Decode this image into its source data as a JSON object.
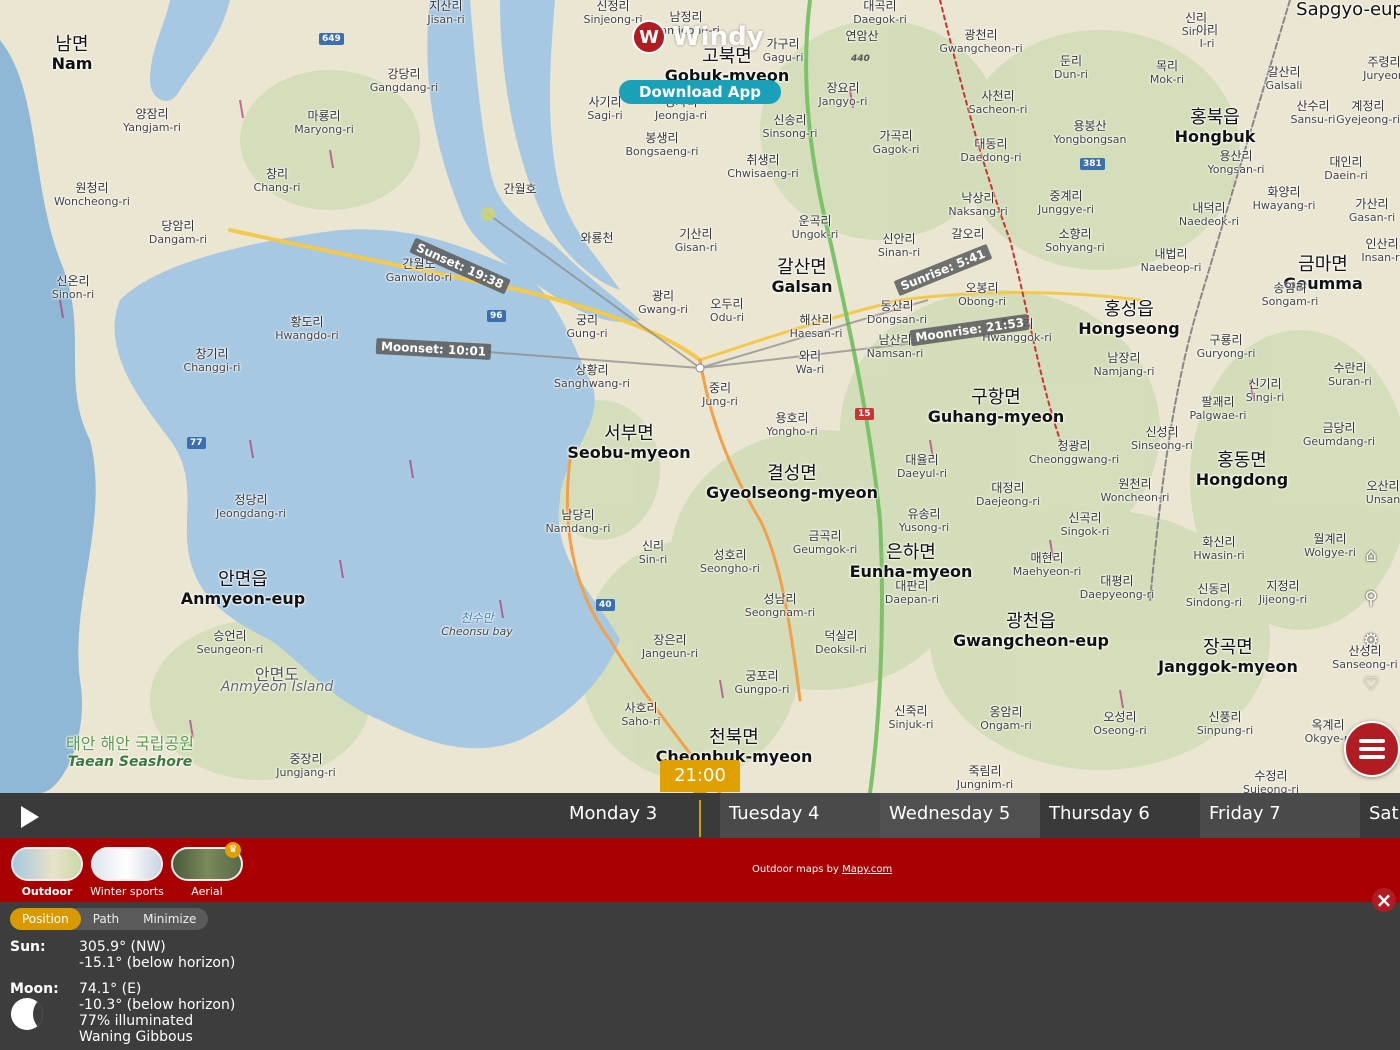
{
  "app": {
    "brand_name": "Windy",
    "download_label": "Download App",
    "brand_color": "#b01c22",
    "accent_color": "#d99a00"
  },
  "map": {
    "overlays": {
      "sunset": "Sunset: 19:38",
      "sunrise": "Sunrise: 5:41",
      "moonset": "Moonset: 10:01",
      "moonrise": "Moonrise: 21:53"
    },
    "road_shields": [
      "649",
      "440",
      "381",
      "96",
      "15",
      "77",
      "40"
    ],
    "places": [
      {
        "ko": "남면",
        "ro": "Nam",
        "big": true
      },
      {
        "ko": "지산리",
        "ro": "Jisan-ri"
      },
      {
        "ko": "신정리",
        "ro": "Sinjeong-ri"
      },
      {
        "ko": "남정리",
        "ro": "Namjeong-ri"
      },
      {
        "ko": "고북면",
        "ro": "Gobuk-myeon",
        "big": true
      },
      {
        "ko": "가구리",
        "ro": "Gagu-ri"
      },
      {
        "ko": "대곡리",
        "ro": "Daegok-ri"
      },
      {
        "ko": "연암산",
        "ro": ""
      },
      {
        "ko": "광천리",
        "ro": "Gwangcheon-ri"
      },
      {
        "ko": "신리",
        "ro": "Sin-ri"
      },
      {
        "ko": "이리",
        "ro": "I-ri"
      },
      {
        "ko": "둔리",
        "ro": "Dun-ri"
      },
      {
        "ko": "목리",
        "ro": "Mok-ri"
      },
      {
        "ko": "갈산리",
        "ro": "Galsali"
      },
      {
        "ko": "주령리",
        "ro": "Juryeon"
      },
      {
        "ko": "강당리",
        "ro": "Gangdang-ri"
      },
      {
        "ko": "사기리",
        "ro": "Sagi-ri"
      },
      {
        "ko": "정자리",
        "ro": "Jeongja-ri"
      },
      {
        "ko": "장요리",
        "ro": "Jangyo-ri"
      },
      {
        "ko": "양잠리",
        "ro": "Yangjam-ri"
      },
      {
        "ko": "마룡리",
        "ro": "Maryong-ri"
      },
      {
        "ko": "봉생리",
        "ro": "Bongsaeng-ri"
      },
      {
        "ko": "신송리",
        "ro": "Sinsong-ri"
      },
      {
        "ko": "가곡리",
        "ro": "Gagok-ri"
      },
      {
        "ko": "사천리",
        "ro": "Sacheon-ri"
      },
      {
        "ko": "대동리",
        "ro": "Daedong-ri"
      },
      {
        "ko": "용봉산",
        "ro": "Yongbongsan"
      },
      {
        "ko": "홍북읍",
        "ro": "Hongbuk",
        "big": true
      },
      {
        "ko": "산수리",
        "ro": "Sansu-ri"
      },
      {
        "ko": "계정리",
        "ro": "Gyejeong-ri"
      },
      {
        "ko": "창리",
        "ro": "Chang-ri"
      },
      {
        "ko": "간월호",
        "ro": ""
      },
      {
        "ko": "취생리",
        "ro": "Chwisaeng-ri"
      },
      {
        "ko": "용산리",
        "ro": "Yongsan-ri"
      },
      {
        "ko": "대인리",
        "ro": "Daein-ri"
      },
      {
        "ko": "원청리",
        "ro": "Woncheong-ri"
      },
      {
        "ko": "당암리",
        "ro": "Dangam-ri"
      },
      {
        "ko": "운곡리",
        "ro": "Ungok-ri"
      },
      {
        "ko": "낙상리",
        "ro": "Naksang-ri"
      },
      {
        "ko": "중계리",
        "ro": "Junggye-ri"
      },
      {
        "ko": "화양리",
        "ro": "Hwayang-ri"
      },
      {
        "ko": "가산리",
        "ro": "Gasan-ri"
      },
      {
        "ko": "와룡천",
        "ro": ""
      },
      {
        "ko": "기산리",
        "ro": "Gisan-ri"
      },
      {
        "ko": "내덕리",
        "ro": "Naedeok-ri"
      },
      {
        "ko": "인산리",
        "ro": "Insan-ri"
      },
      {
        "ko": "간월도",
        "ro": "Ganwoldo-ri"
      },
      {
        "ko": "갈산면",
        "ro": "Galsan",
        "big": true
      },
      {
        "ko": "신안리",
        "ro": "Sinan-ri"
      },
      {
        "ko": "갈오리",
        "ro": ""
      },
      {
        "ko": "소향리",
        "ro": "Sohyang-ri"
      },
      {
        "ko": "내법리",
        "ro": "Naebeop-ri"
      },
      {
        "ko": "금마면",
        "ro": "Geumma",
        "big": true
      },
      {
        "ko": "신온리",
        "ro": "Sinon-ri"
      },
      {
        "ko": "광리",
        "ro": "Gwang-ri"
      },
      {
        "ko": "오두리",
        "ro": "Odu-ri"
      },
      {
        "ko": "오봉리",
        "ro": "Obong-ri"
      },
      {
        "ko": "홍성읍",
        "ro": "Hongseong",
        "big": true
      },
      {
        "ko": "송암리",
        "ro": "Songam-ri"
      },
      {
        "ko": "황도리",
        "ro": "Hwangdo-ri"
      },
      {
        "ko": "궁리",
        "ro": "Gung-ri"
      },
      {
        "ko": "해산리",
        "ro": "Haesan-ri"
      },
      {
        "ko": "동산리",
        "ro": "Dongsan-ri"
      },
      {
        "ko": "황곡리",
        "ro": "Hwanggok-ri"
      },
      {
        "ko": "구룡리",
        "ro": "Guryong-ri"
      },
      {
        "ko": "창기리",
        "ro": "Changgi-ri"
      },
      {
        "ko": "상황리",
        "ro": "Sanghwang-ri"
      },
      {
        "ko": "와리",
        "ro": "Wa-ri"
      },
      {
        "ko": "남산리",
        "ro": "Namsan-ri"
      },
      {
        "ko": "남장리",
        "ro": "Namjang-ri"
      },
      {
        "ko": "수란리",
        "ro": "Suran-ri"
      },
      {
        "ko": "중리",
        "ro": "Jung-ri"
      },
      {
        "ko": "구항면",
        "ro": "Guhang-myeon",
        "big": true
      },
      {
        "ko": "신기리",
        "ro": "Singi-ri"
      },
      {
        "ko": "팔괘리",
        "ro": "Palgwae-ri"
      },
      {
        "ko": "용호리",
        "ro": "Yongho-ri"
      },
      {
        "ko": "서부면",
        "ro": "Seobu-myeon",
        "big": true
      },
      {
        "ko": "청광리",
        "ro": "Cheonggwang-ri"
      },
      {
        "ko": "신성리",
        "ro": "Sinseong-ri"
      },
      {
        "ko": "금당리",
        "ro": "Geumdang-ri"
      },
      {
        "ko": "대율리",
        "ro": "Daeyul-ri"
      },
      {
        "ko": "결성면",
        "ro": "Gyeolseong-myeon",
        "big": true
      },
      {
        "ko": "홍동면",
        "ro": "Hongdong",
        "big": true
      },
      {
        "ko": "원천리",
        "ro": "Woncheon-ri"
      },
      {
        "ko": "오산리",
        "ro": "Unsan"
      },
      {
        "ko": "대정리",
        "ro": "Daejeong-ri"
      },
      {
        "ko": "신곡리",
        "ro": "Singok-ri"
      },
      {
        "ko": "정당리",
        "ro": "Jeongdang-ri"
      },
      {
        "ko": "남당리",
        "ro": "Namdang-ri"
      },
      {
        "ko": "유송리",
        "ro": "Yusong-ri"
      },
      {
        "ko": "금곡리",
        "ro": "Geumgok-ri"
      },
      {
        "ko": "신리",
        "ro": "Sin-ri"
      },
      {
        "ko": "화신리",
        "ro": "Hwasin-ri"
      },
      {
        "ko": "월계리",
        "ro": "Wolgye-ri"
      },
      {
        "ko": "은하면",
        "ro": "Eunha-myeon",
        "big": true
      },
      {
        "ko": "성호리",
        "ro": "Seongho-ri"
      },
      {
        "ko": "매현리",
        "ro": "Maehyeon-ri"
      },
      {
        "ko": "대평리",
        "ro": "Daepyeong-ri"
      },
      {
        "ko": "안면읍",
        "ro": "Anmyeon-eup",
        "big": true
      },
      {
        "ko": "신동리",
        "ro": "Sindong-ri"
      },
      {
        "ko": "지정리",
        "ro": "Jijeong-ri"
      },
      {
        "ko": "대판리",
        "ro": "Daepan-ri"
      },
      {
        "ko": "성남리",
        "ro": "Seongnam-ri"
      },
      {
        "ko": "천수만",
        "ro": "Cheonsu bay",
        "water": true
      },
      {
        "ko": "광천읍",
        "ro": "Gwangcheon-eup",
        "big": true
      },
      {
        "ko": "장곡면",
        "ro": "Janggok-myeon",
        "big": true
      },
      {
        "ko": "승언리",
        "ro": "Seungeon-ri"
      },
      {
        "ko": "장은리",
        "ro": "Jangeun-ri"
      },
      {
        "ko": "덕실리",
        "ro": "Deoksil-ri"
      },
      {
        "ko": "산성리",
        "ro": "Sanseong-ri"
      },
      {
        "ko": "안면도",
        "ro": "Anmyeon Island",
        "island": true
      },
      {
        "ko": "궁포리",
        "ro": "Gungpo-ri"
      },
      {
        "ko": "사호리",
        "ro": "Saho-ri"
      },
      {
        "ko": "신죽리",
        "ro": "Sinjuk-ri"
      },
      {
        "ko": "옹암리",
        "ro": "Ongam-ri"
      },
      {
        "ko": "오성리",
        "ro": "Oseong-ri"
      },
      {
        "ko": "신풍리",
        "ro": "Sinpung-ri"
      },
      {
        "ko": "옥계리",
        "ro": "Okgye-ri"
      },
      {
        "ko": "태안 해안 국립공원",
        "ro": "Taean Seashore",
        "park": true
      },
      {
        "ko": "천북면",
        "ro": "Cheonbuk-myeon",
        "big": true
      },
      {
        "ko": "중장리",
        "ro": "Jungjang-ri"
      },
      {
        "ko": "죽림리",
        "ro": "Jungnim-ri"
      },
      {
        "ko": "수정리",
        "ro": "Sujeong-ri"
      },
      {
        "ko": "Sapgyo-eup",
        "ro": "",
        "big": true
      }
    ]
  },
  "timeline": {
    "current_time": "21:00",
    "days": [
      "Monday 3",
      "Tuesday 4",
      "Wednesday 5",
      "Thursday 6",
      "Friday 7",
      "Sat"
    ]
  },
  "layers": {
    "items": [
      {
        "label": "Outdoor",
        "active": true
      },
      {
        "label": "Winter sports",
        "active": false
      },
      {
        "label": "Aerial",
        "active": false
      }
    ],
    "attribution_prefix": "Outdoor maps by",
    "attribution_link": "Mapy.com"
  },
  "panel": {
    "tabs": [
      "Position",
      "Path",
      "Minimize"
    ],
    "active_tab": "Position",
    "sun_label": "Sun:",
    "sun_lines": [
      "305.9° (NW)",
      "-15.1° (below horizon)"
    ],
    "moon_label": "Moon:",
    "moon_lines": [
      "74.1° (E)",
      "-10.3° (below horizon)",
      "77% illuminated",
      "Waning Gibbous"
    ],
    "moon_illumination": 0.77
  }
}
